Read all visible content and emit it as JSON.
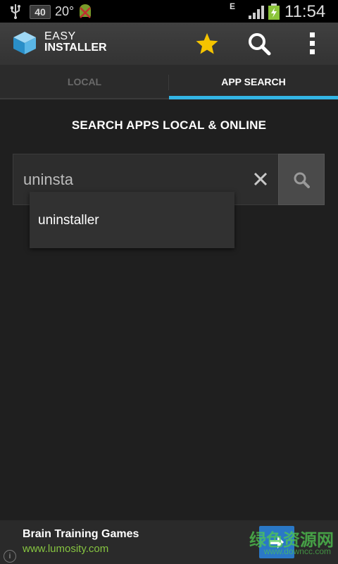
{
  "status_bar": {
    "badge": "40",
    "temperature": "20°",
    "network_type": "E",
    "time": "11:54",
    "icons": [
      "usb-icon",
      "android-debug-icon",
      "signal-icon",
      "battery-charging-icon"
    ]
  },
  "app": {
    "title_line1": "EASY",
    "title_line2": "INSTALLER",
    "icons": [
      "app-logo-icon",
      "star-icon",
      "search-icon",
      "overflow-menu-icon"
    ],
    "accent_color": "#33b5e5",
    "star_color": "#f5c400"
  },
  "tabs": [
    {
      "label": "LOCAL",
      "selected": false
    },
    {
      "label": "APP SEARCH",
      "selected": true
    }
  ],
  "main": {
    "heading": "SEARCH APPS LOCAL & ONLINE",
    "search": {
      "value": "uninsta"
    },
    "suggestions": [
      "uninstaller"
    ]
  },
  "ad": {
    "title": "Brain Training Games",
    "url": "www.lumosity.com",
    "info_label": "i",
    "url_color": "#86c441",
    "button_color": "#2a78c6"
  },
  "watermark": {
    "text": "绿色资源网",
    "sub": "www.downcc.com"
  }
}
